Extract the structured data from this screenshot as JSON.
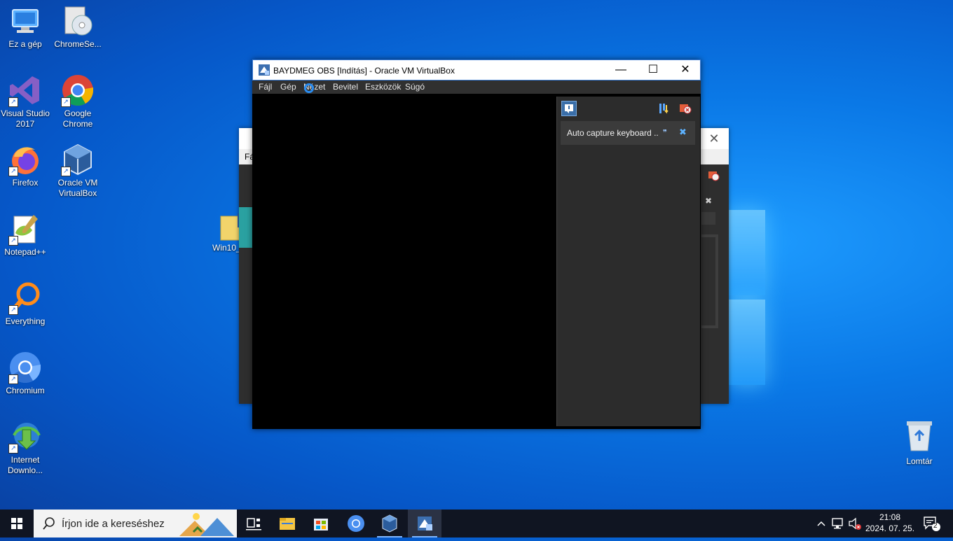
{
  "desktop": {
    "icons": [
      {
        "label": "Ez a gép",
        "icon": "computer-icon"
      },
      {
        "label": "ChromeSe...",
        "icon": "setup-cd-icon"
      },
      {
        "label": "Visual Studio 2017",
        "icon": "visual-studio-icon"
      },
      {
        "label": "Google Chrome",
        "icon": "chrome-icon"
      },
      {
        "label": "Firefox",
        "icon": "firefox-icon"
      },
      {
        "label": "Oracle VM VirtualBox",
        "icon": "virtualbox-icon"
      },
      {
        "label": "Notepad++",
        "icon": "notepadpp-icon"
      },
      {
        "label": "Everything",
        "icon": "everything-search-icon"
      },
      {
        "label": "Chromium",
        "icon": "chromium-icon"
      },
      {
        "label": "Internet Downlo...",
        "icon": "idm-icon"
      },
      {
        "label": "Win10_",
        "icon": "folder-icon"
      },
      {
        "label": "Lomtár",
        "icon": "recycle-bin-icon"
      }
    ]
  },
  "background_window": {
    "menu_first_letter": "Fá"
  },
  "vbox_window": {
    "title": "BAYDMEG OBS [Indítás] - Oracle VM VirtualBox",
    "menu": [
      "Fájl",
      "Gép",
      "Nézet",
      "Bevitel",
      "Eszközök",
      "Súgó"
    ],
    "notification": {
      "text": "Auto capture keyboard ..."
    }
  },
  "taskbar": {
    "search_placeholder": "Írjon ide a kereséshez",
    "clock_time": "21:08",
    "clock_date": "2024. 07. 25.",
    "notification_count": "2"
  },
  "colors": {
    "accent": "#2a8cf0",
    "taskbar": "#101522",
    "vm_panel": "#2c2c2c"
  }
}
